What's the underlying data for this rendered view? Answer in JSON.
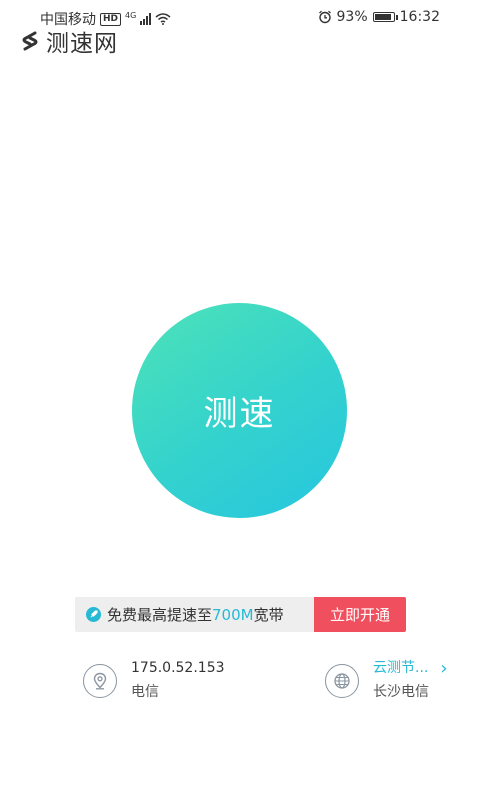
{
  "status_bar": {
    "carrier": "中国移动",
    "hd": "HD",
    "network": "4G",
    "battery": "93%",
    "battery_level": 0.93,
    "time": "16:32"
  },
  "app": {
    "logo_text": "测速网"
  },
  "main": {
    "speed_test_label": "测速"
  },
  "promo": {
    "text_prefix": "免费最高提速至",
    "text_highlight": "700M",
    "text_suffix": "宽带",
    "button_label": "立即开通"
  },
  "ip_info": {
    "ip": "175.0.52.153",
    "isp": "电信"
  },
  "node_info": {
    "label": "云测节...",
    "location": "长沙电信"
  },
  "colors": {
    "accent": "#26b9d4",
    "promo_button": "#f0505e",
    "circle_start": "#4ee3b8",
    "circle_end": "#26c6e0"
  }
}
